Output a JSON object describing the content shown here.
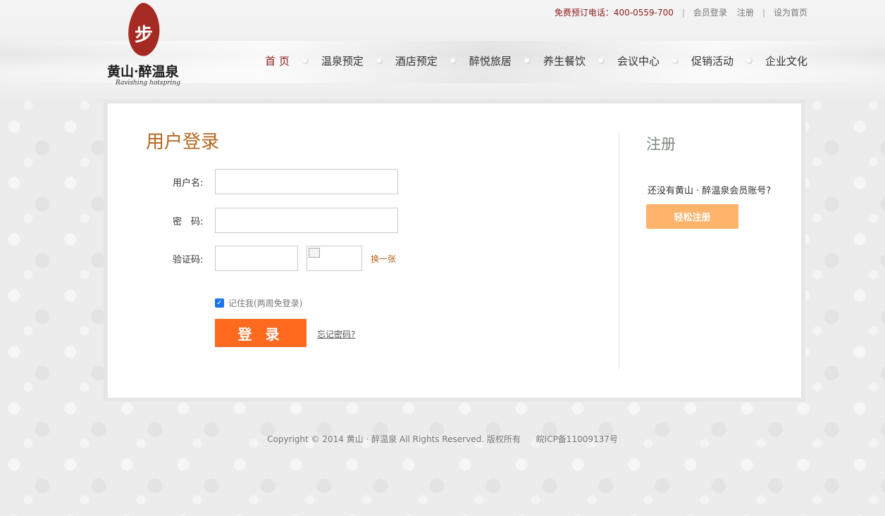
{
  "header": {
    "logo": {
      "seal_text": "步",
      "name_cn": "黄山·醉温泉",
      "name_en": "Ravishing hotspring"
    },
    "top_links": {
      "phone": "免费预订电话：400-0559-700",
      "member_login": "会员登录",
      "register": "注册",
      "set_homepage": "设为首页"
    },
    "nav": [
      {
        "label": "首 页",
        "active": true
      },
      {
        "label": "温泉预定",
        "active": false
      },
      {
        "label": "酒店预定",
        "active": false
      },
      {
        "label": "醉悦旅居",
        "active": false
      },
      {
        "label": "养生餐饮",
        "active": false
      },
      {
        "label": "会议中心",
        "active": false
      },
      {
        "label": "促销活动",
        "active": false
      },
      {
        "label": "企业文化",
        "active": false
      }
    ]
  },
  "login": {
    "title": "用户登录",
    "username_label": "用户名:",
    "password_label": "密　码:",
    "captcha_label": "验证码:",
    "change_captcha": "换一张",
    "remember_me": "记住我(两周免登录)",
    "remember_checked": true,
    "submit": "登 录",
    "forgot_password": "忘记密码?"
  },
  "register": {
    "title": "注册",
    "prompt": "还没有黄山 · 醉温泉会员账号?",
    "button": "轻松注册"
  },
  "footer": {
    "copyright": "Copyright © 2014 黄山 · 醉温泉 All Rights Reserved. 版权所有",
    "icp": "皖ICP备11009137号"
  },
  "colors": {
    "brand_red": "#8b1a1a",
    "title_orange": "#b5651d",
    "login_button": "#ff6a1f",
    "register_button": "#ffb36b"
  }
}
